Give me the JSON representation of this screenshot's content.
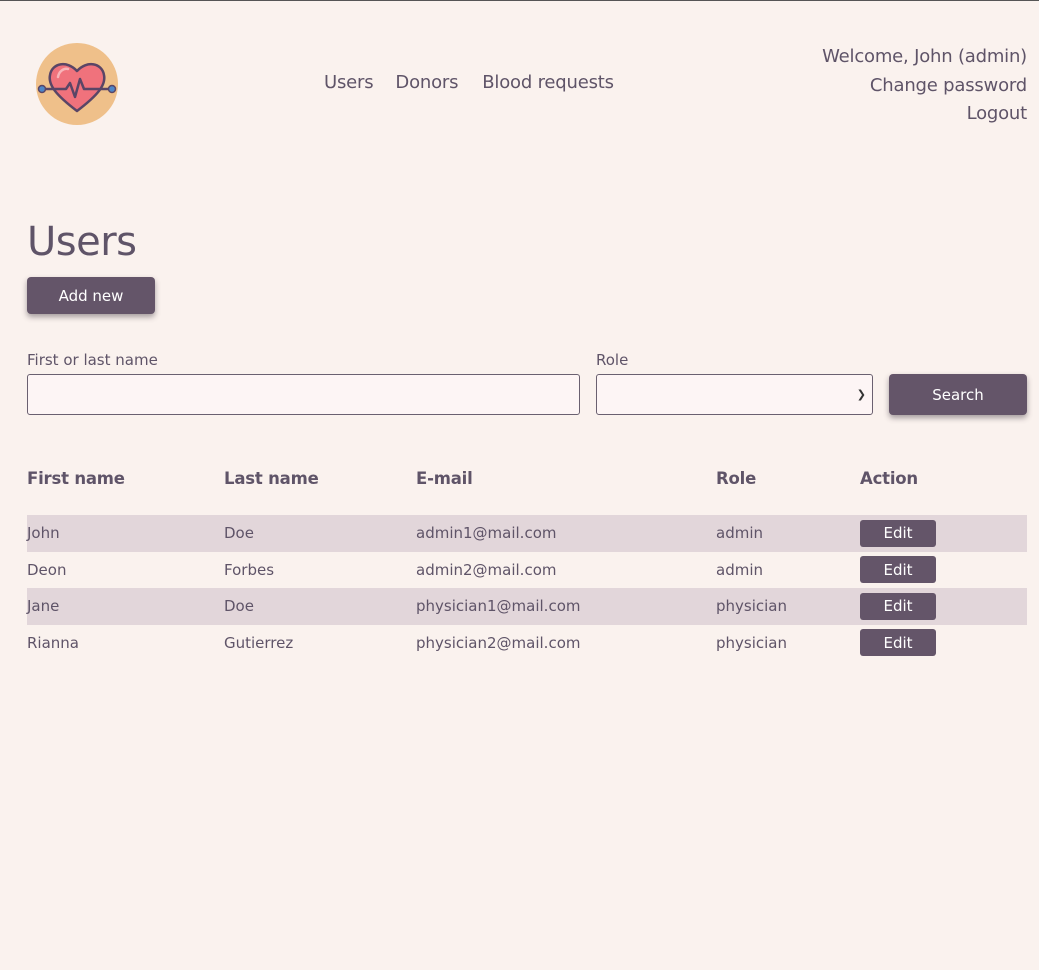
{
  "header": {
    "nav": [
      "Users",
      "Donors",
      "Blood requests"
    ],
    "welcome": "Welcome, John (admin)",
    "change_password": "Change password",
    "logout": "Logout"
  },
  "page": {
    "title": "Users",
    "add_new": "Add new"
  },
  "filters": {
    "name_label": "First or last name",
    "name_value": "",
    "role_label": "Role",
    "role_value": "",
    "search_label": "Search"
  },
  "table": {
    "columns": [
      "First name",
      "Last name",
      "E-mail",
      "Role",
      "Action"
    ],
    "edit_label": "Edit",
    "rows": [
      {
        "first": "John",
        "last": "Doe",
        "email": "admin1@mail.com",
        "role": "admin"
      },
      {
        "first": "Deon",
        "last": "Forbes",
        "email": "admin2@mail.com",
        "role": "admin"
      },
      {
        "first": "Jane",
        "last": "Doe",
        "email": "physician1@mail.com",
        "role": "physician"
      },
      {
        "first": "Rianna",
        "last": "Gutierrez",
        "email": "physician2@mail.com",
        "role": "physician"
      }
    ]
  },
  "colors": {
    "background": "#faf2ee",
    "accent": "#645569",
    "row_shade": "#e2d6da",
    "logo_circle": "#efc08a",
    "heart": "#f0727c"
  }
}
